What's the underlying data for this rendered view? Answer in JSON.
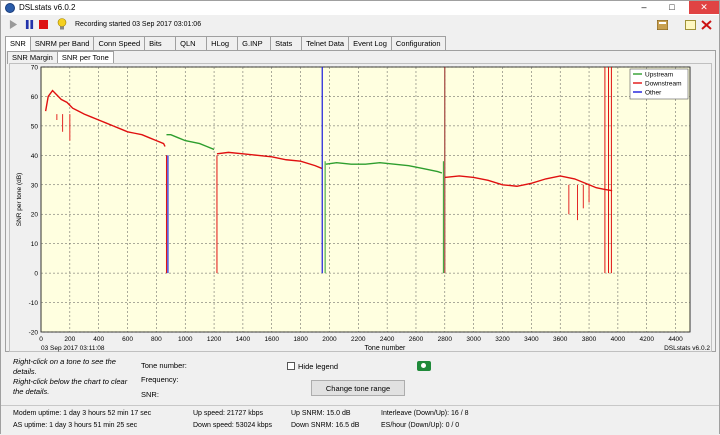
{
  "window": {
    "title": "DSLstats v6.0.2",
    "controls": {
      "minimize": "–",
      "maximize": "□",
      "close": "✕"
    }
  },
  "toolbar": {
    "recording_status": "Recording started 03 Sep 2017 03:01:06",
    "icons": [
      "play-icon",
      "pause-icon",
      "stop-icon",
      "bulb-icon",
      "calculator-icon",
      "window-icon",
      "close-red-icon"
    ]
  },
  "main_tabs": [
    "SNR",
    "SNRM per Band",
    "Conn Speed",
    "Bits",
    "QLN",
    "HLog",
    "G.INP",
    "Stats",
    "Telnet Data",
    "Event Log",
    "Configuration"
  ],
  "active_main_tab": "SNR",
  "sub_tabs": [
    "SNR Margin",
    "SNR per Tone"
  ],
  "active_sub_tab": "SNR per Tone",
  "chart_data": {
    "type": "line",
    "xlabel": "Tone number",
    "ylabel": "SNR per tone (dB)",
    "xlim": [
      0,
      4500
    ],
    "ylim": [
      -20,
      70
    ],
    "x_ticks": [
      200,
      400,
      600,
      800,
      1000,
      1200,
      1400,
      1600,
      1800,
      2000,
      2200,
      2400,
      2600,
      2800,
      3000,
      3200,
      3400,
      3600,
      3800,
      4000,
      4200,
      4400
    ],
    "y_ticks": [
      70,
      60,
      50,
      40,
      30,
      20,
      10,
      0,
      -10,
      -20
    ],
    "grid": true,
    "background": "#ffffe0",
    "timestamp": "03 Sep 2017 03:11:08",
    "version_label": "DSLstats v6.0.2",
    "legend_position": "top-right",
    "series": [
      {
        "name": "Upstream",
        "color": "#2e9e2e",
        "segments": [
          {
            "x": [
              870,
              900,
              950,
              1000,
              1050,
              1100,
              1150,
              1200
            ],
            "y": [
              47,
              47,
              46,
              45,
              44.5,
              44,
              43,
              42
            ]
          },
          {
            "x": [
              1975,
              2050,
              2150,
              2250,
              2350,
              2450,
              2550,
              2650,
              2750,
              2780
            ],
            "y": [
              37,
              37.5,
              37,
              37,
              37.5,
              37,
              36.5,
              35.5,
              34.5,
              34
            ]
          }
        ]
      },
      {
        "name": "Downstream",
        "color": "#e01010",
        "segments": [
          {
            "x": [
              32,
              50,
              80,
              100,
              140,
              180,
              220,
              260,
              300,
              350,
              400,
              450,
              500,
              550,
              600,
              650,
              700,
              750,
              800,
              850,
              860
            ],
            "y": [
              55,
              60,
              62,
              61,
              59,
              58,
              56,
              55,
              54,
              53,
              52,
              51,
              50,
              49,
              48,
              47.5,
              47,
              46,
              45,
              44,
              43
            ]
          },
          {
            "x": [
              1220,
              1300,
              1400,
              1500,
              1600,
              1700,
              1800,
              1900,
              1950
            ],
            "y": [
              40.5,
              41,
              40.5,
              40,
              39.5,
              38.5,
              38,
              36.5,
              35.5
            ]
          },
          {
            "x": [
              2800,
              2900,
              3000,
              3100,
              3200,
              3300,
              3400,
              3500,
              3600,
              3700,
              3800,
              3850,
              3900,
              3960
            ],
            "y": [
              32.5,
              33,
              32.5,
              31.5,
              30,
              29.5,
              30.5,
              32,
              33,
              32,
              30,
              29,
              28.5,
              28
            ]
          }
        ],
        "spikes_x": [
          870,
          1220,
          2800,
          3910,
          3935,
          3955
        ],
        "dips": [
          {
            "x": 110,
            "y": 52
          },
          {
            "x": 150,
            "y": 48
          },
          {
            "x": 200,
            "y": 45
          },
          {
            "x": 3660,
            "y": 20
          },
          {
            "x": 3720,
            "y": 18
          },
          {
            "x": 3760,
            "y": 22
          },
          {
            "x": 3800,
            "y": 24
          }
        ]
      },
      {
        "name": "Other",
        "color": "#1a1adc",
        "markers_x": [
          880,
          1950
        ]
      }
    ]
  },
  "info": {
    "hint1": "Right-click on a tone to see the details.",
    "hint2": "Right-click below the chart to clear the details.",
    "tone_number_label": "Tone number:",
    "frequency_label": "Frequency:",
    "snr_label": "SNR:",
    "hide_legend_label": "Hide legend",
    "change_range_button": "Change tone range"
  },
  "status": {
    "modem_uptime": "Modem uptime: 1 day 3 hours 52 min 17 sec",
    "as_uptime": "AS uptime: 1 day 3 hours 51 min 25 sec",
    "up_speed": "Up speed: 21727 kbps",
    "down_speed": "Down speed: 53024 kbps",
    "up_snrm": "Up SNRM: 15.0 dB",
    "down_snrm": "Down SNRM: 16.5 dB",
    "interleave": "Interleave (Down/Up): 16 / 8",
    "es_hour": "ES/hour (Down/Up): 0 / 0"
  }
}
